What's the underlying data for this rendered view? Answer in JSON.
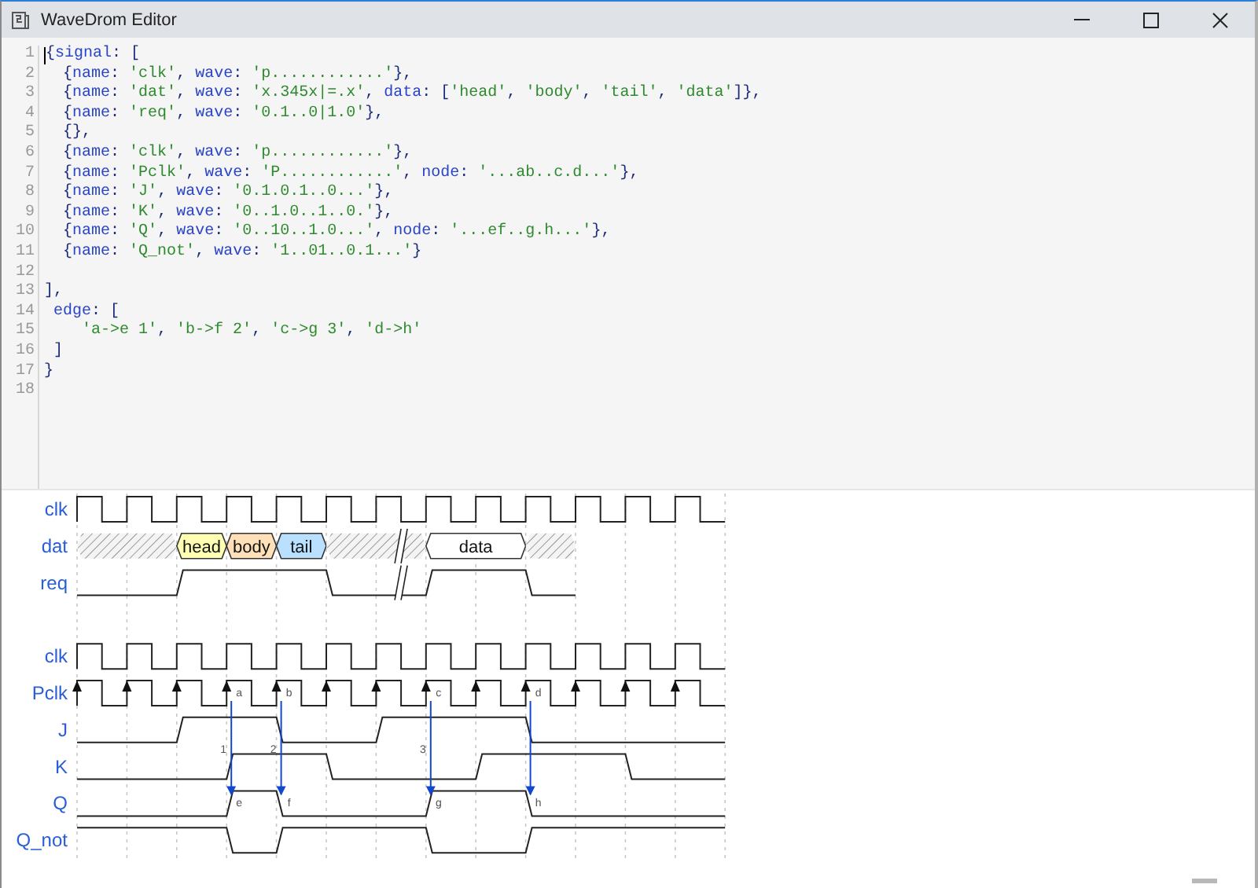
{
  "window": {
    "title": "WaveDrom Editor"
  },
  "editor": {
    "lines": [
      {
        "number": "1",
        "text": "{signal: ["
      },
      {
        "number": "2",
        "text": "  {name: 'clk', wave: 'p............'},"
      },
      {
        "number": "3",
        "text": "  {name: 'dat', wave: 'x.345x|=.x', data: ['head', 'body', 'tail', 'data']},"
      },
      {
        "number": "4",
        "text": "  {name: 'req', wave: '0.1..0|1.0'},"
      },
      {
        "number": "5",
        "text": "  {},"
      },
      {
        "number": "6",
        "text": "  {name: 'clk', wave: 'p............'},"
      },
      {
        "number": "7",
        "text": "  {name: 'Pclk', wave: 'P............', node: '...ab..c.d...'},"
      },
      {
        "number": "8",
        "text": "  {name: 'J', wave: '0.1.0.1..0...'},"
      },
      {
        "number": "9",
        "text": "  {name: 'K', wave: '0..1.0..1..0.'},"
      },
      {
        "number": "10",
        "text": "  {name: 'Q', wave: '0..10..1.0...', node: '...ef..g.h...'},"
      },
      {
        "number": "11",
        "text": "  {name: 'Q_not', wave: '1..01..0.1...'}"
      },
      {
        "number": "12"
      },
      {
        "number": "13",
        "text": "],"
      },
      {
        "number": "14",
        "text": " edge: ["
      },
      {
        "number": "15",
        "text": "    'a->e 1', 'b->f 2', 'c->g 3', 'd->h'"
      },
      {
        "number": "16",
        "text": " ]"
      },
      {
        "number": "17",
        "text": "}"
      },
      {
        "number": "18"
      }
    ]
  },
  "diagram": {
    "signals": [
      {
        "kind": "wave",
        "name": "clk",
        "steps": [
          {
            "kind": "clock"
          },
          {
            "kind": "same"
          },
          {
            "kind": "same"
          },
          {
            "kind": "same"
          },
          {
            "kind": "same"
          },
          {
            "kind": "same"
          },
          {
            "kind": "same"
          },
          {
            "kind": "same"
          },
          {
            "kind": "same"
          },
          {
            "kind": "same"
          },
          {
            "kind": "same"
          },
          {
            "kind": "same"
          },
          {
            "kind": "same"
          }
        ]
      },
      {
        "kind": "wave",
        "name": "dat",
        "steps": [
          {
            "kind": "unknown"
          },
          {
            "kind": "same"
          },
          {
            "kind": "data",
            "label": "head",
            "color": "#ffffb4"
          },
          {
            "kind": "data",
            "label": "body",
            "color": "#ffe0b9"
          },
          {
            "kind": "data",
            "label": "tail",
            "color": "#b9e0ff"
          },
          {
            "kind": "unknown"
          },
          {
            "kind": "gap"
          },
          {
            "kind": "data",
            "label": "data",
            "color": "#ffffff"
          },
          {
            "kind": "same"
          },
          {
            "kind": "unknown"
          }
        ]
      },
      {
        "kind": "wave",
        "name": "req",
        "steps": [
          {
            "kind": "low"
          },
          {
            "kind": "same"
          },
          {
            "kind": "high"
          },
          {
            "kind": "same"
          },
          {
            "kind": "same"
          },
          {
            "kind": "low"
          },
          {
            "kind": "gap"
          },
          {
            "kind": "high"
          },
          {
            "kind": "same"
          },
          {
            "kind": "low"
          }
        ]
      },
      {
        "kind": "spacer"
      },
      {
        "kind": "wave",
        "name": "clk",
        "steps": [
          {
            "kind": "clock"
          },
          {
            "kind": "same"
          },
          {
            "kind": "same"
          },
          {
            "kind": "same"
          },
          {
            "kind": "same"
          },
          {
            "kind": "same"
          },
          {
            "kind": "same"
          },
          {
            "kind": "same"
          },
          {
            "kind": "same"
          },
          {
            "kind": "same"
          },
          {
            "kind": "same"
          },
          {
            "kind": "same"
          },
          {
            "kind": "same"
          }
        ]
      },
      {
        "kind": "wave",
        "name": "Pclk",
        "steps": [
          {
            "kind": "clock-arrow"
          },
          {
            "kind": "same"
          },
          {
            "kind": "same"
          },
          {
            "kind": "same",
            "node": "a"
          },
          {
            "kind": "same",
            "node": "b"
          },
          {
            "kind": "same"
          },
          {
            "kind": "same"
          },
          {
            "kind": "same",
            "node": "c"
          },
          {
            "kind": "same"
          },
          {
            "kind": "same",
            "node": "d"
          },
          {
            "kind": "same"
          },
          {
            "kind": "same"
          },
          {
            "kind": "same"
          }
        ]
      },
      {
        "kind": "wave",
        "name": "J",
        "steps": [
          {
            "kind": "low"
          },
          {
            "kind": "same"
          },
          {
            "kind": "high"
          },
          {
            "kind": "same"
          },
          {
            "kind": "low"
          },
          {
            "kind": "same"
          },
          {
            "kind": "high"
          },
          {
            "kind": "same"
          },
          {
            "kind": "same"
          },
          {
            "kind": "low"
          },
          {
            "kind": "same"
          },
          {
            "kind": "same"
          },
          {
            "kind": "same"
          }
        ]
      },
      {
        "kind": "wave",
        "name": "K",
        "steps": [
          {
            "kind": "low"
          },
          {
            "kind": "same"
          },
          {
            "kind": "same"
          },
          {
            "kind": "high"
          },
          {
            "kind": "same"
          },
          {
            "kind": "low"
          },
          {
            "kind": "same"
          },
          {
            "kind": "same"
          },
          {
            "kind": "high"
          },
          {
            "kind": "same"
          },
          {
            "kind": "same"
          },
          {
            "kind": "low"
          },
          {
            "kind": "same"
          }
        ]
      },
      {
        "kind": "wave",
        "name": "Q",
        "steps": [
          {
            "kind": "low"
          },
          {
            "kind": "same"
          },
          {
            "kind": "same"
          },
          {
            "kind": "high",
            "node": "e"
          },
          {
            "kind": "low",
            "node": "f"
          },
          {
            "kind": "same"
          },
          {
            "kind": "same"
          },
          {
            "kind": "high",
            "node": "g"
          },
          {
            "kind": "same"
          },
          {
            "kind": "low",
            "node": "h"
          },
          {
            "kind": "same"
          },
          {
            "kind": "same"
          },
          {
            "kind": "same"
          }
        ]
      },
      {
        "kind": "wave",
        "name": "Q_not",
        "steps": [
          {
            "kind": "high"
          },
          {
            "kind": "same"
          },
          {
            "kind": "same"
          },
          {
            "kind": "low"
          },
          {
            "kind": "high"
          },
          {
            "kind": "same"
          },
          {
            "kind": "same"
          },
          {
            "kind": "low"
          },
          {
            "kind": "same"
          },
          {
            "kind": "high"
          },
          {
            "kind": "same"
          },
          {
            "kind": "same"
          },
          {
            "kind": "same"
          }
        ]
      }
    ],
    "edges": [
      {
        "kind": "arrow",
        "label": "1"
      },
      {
        "kind": "arrow",
        "label": "2"
      },
      {
        "kind": "arrow",
        "label": "3"
      },
      {
        "kind": "arrow"
      }
    ]
  }
}
